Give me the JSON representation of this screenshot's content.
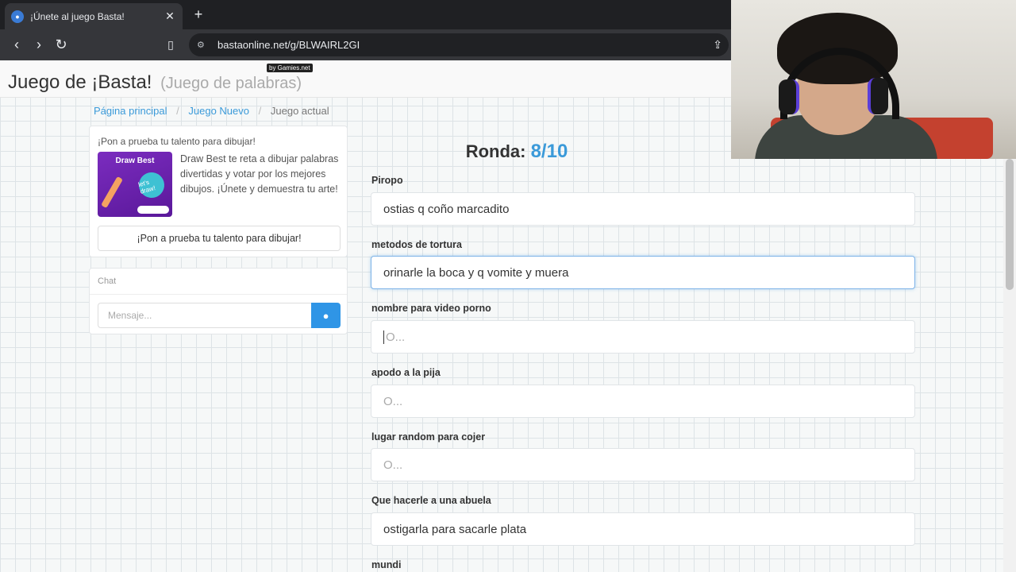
{
  "browser": {
    "tab_title": "¡Únete al juego Basta!",
    "tab_close": "✕",
    "new_tab": "+",
    "url": "bastaonline.net/g/BLWAIRL2GI"
  },
  "header": {
    "brand": "Juego de ¡Basta!",
    "brand_sub": "(Juego de palabras)",
    "badge": "by Gamies.net"
  },
  "breadcrumb": {
    "home": "Página principal",
    "new_game": "Juego Nuevo",
    "current": "Juego actual"
  },
  "promo": {
    "title": "¡Pon a prueba tu talento para dibujar!",
    "image_title": "Draw Best",
    "image_badge": "let's draw!",
    "description": "Draw Best te reta a dibujar palabras divertidas y votar por los mejores dibujos. ¡Únete y demuestra tu arte!",
    "button": "¡Pon a prueba tu talento para dibujar!"
  },
  "chat": {
    "title": "Chat",
    "placeholder": "Mensaje..."
  },
  "round": {
    "label": "Ronda:",
    "value": "8/10"
  },
  "fields": [
    {
      "label": "Piropo",
      "value": "ostias q coño marcadito"
    },
    {
      "label": "metodos de tortura",
      "value": "orinarle la boca y q vomite y muera"
    },
    {
      "label": "nombre para video porno",
      "value": "O..."
    },
    {
      "label": "apodo a la pija",
      "value": "O..."
    },
    {
      "label": "lugar random para cojer",
      "value": "O..."
    },
    {
      "label": "Que hacerle a una abuela",
      "value": "ostigarla para sacarle plata"
    },
    {
      "label": "mundi",
      "value": ""
    }
  ]
}
